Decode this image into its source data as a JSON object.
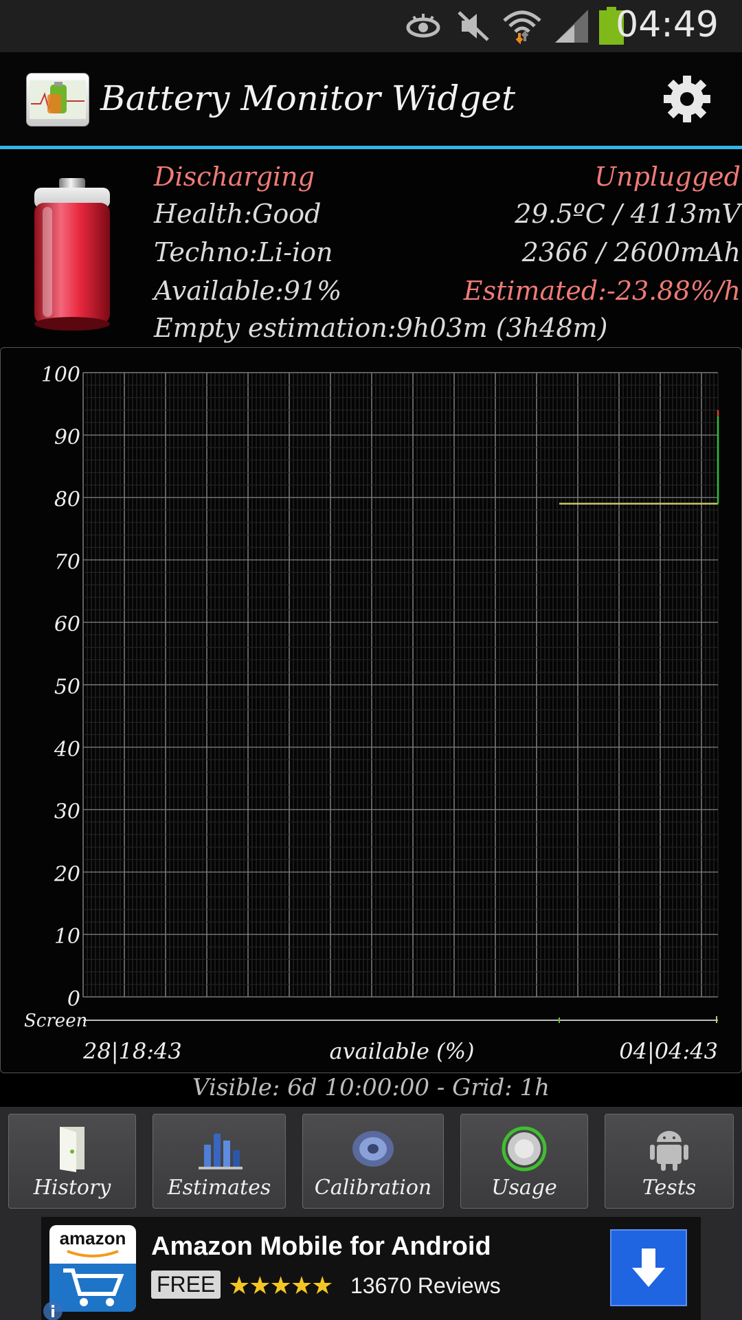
{
  "status_bar": {
    "time": "04:49",
    "icons": [
      "eye-icon",
      "mute-icon",
      "wifi-icon",
      "signal-icon",
      "battery-icon"
    ],
    "battery_color": "#7fba1a"
  },
  "action_bar": {
    "title": "Battery Monitor Widget",
    "settings_icon": "gear-icon",
    "accent_color": "#33b5e5"
  },
  "info": {
    "state": "Discharging",
    "plug": "Unplugged",
    "health": "Health:Good",
    "temp_voltage": "29.5ºC / 4113mV",
    "techno": "Techno:Li-ion",
    "capacity": "2366 / 2600mAh",
    "available": "Available:91%",
    "estimated": "Estimated:-23.88%/h",
    "empty_estimation": "Empty estimation:9h03m (3h48m)"
  },
  "chart_data": {
    "type": "line",
    "y_ticks": [
      "100",
      "90",
      "80",
      "70",
      "60",
      "50",
      "40",
      "30",
      "20",
      "10",
      "0"
    ],
    "ylim": [
      0,
      100
    ],
    "x_start_label": "28|18:43",
    "x_end_label": "04|04:43",
    "xlabel": "available (%)",
    "screen_label": "Screen",
    "grid": true,
    "series": [
      {
        "color": "#c8c86a",
        "points": [
          [
            0.75,
            79
          ],
          [
            1.0,
            79
          ]
        ]
      },
      {
        "color": "#2fbf3a",
        "points": [
          [
            1.0,
            79
          ],
          [
            1.0,
            93
          ]
        ]
      },
      {
        "color": "#e23a2a",
        "points": [
          [
            1.0,
            93
          ],
          [
            1.0,
            94
          ]
        ]
      }
    ]
  },
  "visible_info": "Visible: 6d 10:00:00 - Grid: 1h",
  "nav": {
    "history": "History",
    "estimates": "Estimates",
    "calibration": "Calibration",
    "usage": "Usage",
    "tests": "Tests"
  },
  "ad": {
    "logo_text": "amazon",
    "title": "Amazon Mobile for Android",
    "price": "FREE",
    "stars": "★★★★★",
    "reviews": "13670 Reviews"
  }
}
